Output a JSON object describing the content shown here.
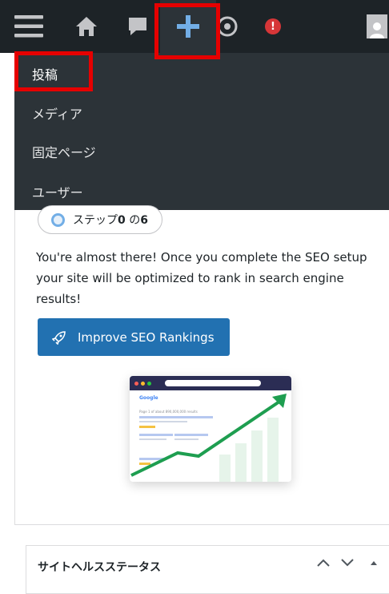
{
  "adminbar": {
    "icons": [
      "menu-icon",
      "home-icon",
      "comment-icon",
      "plus-icon",
      "wordpress-icon",
      "notification-icon",
      "avatar-icon"
    ],
    "badge_text": "!",
    "colors": {
      "bar": "#1d2327",
      "accent": "#72aee6",
      "badge": "#d63638",
      "highlight": "#e60000"
    }
  },
  "new_menu": {
    "items": [
      {
        "label": "投稿"
      },
      {
        "label": "メディア"
      },
      {
        "label": "固定ページ"
      },
      {
        "label": "ユーザー"
      }
    ]
  },
  "seo_card": {
    "step_prefix": "ステップ",
    "step_current": "0",
    "step_mid": " の",
    "step_total": "6",
    "description": "You're almost there! Once you complete the SEO setup your site will be optimized to rank in search engine results!",
    "button_label": "Improve SEO Rankings",
    "button_color": "#2271b1",
    "illustration": {
      "brand": "Google",
      "results_text": "Page 1 of about 890,000,000 results"
    }
  },
  "site_health": {
    "title": "サイトヘルスステータス",
    "controls": [
      "chevron-up-icon",
      "chevron-down-icon",
      "triangle-up-icon"
    ]
  }
}
